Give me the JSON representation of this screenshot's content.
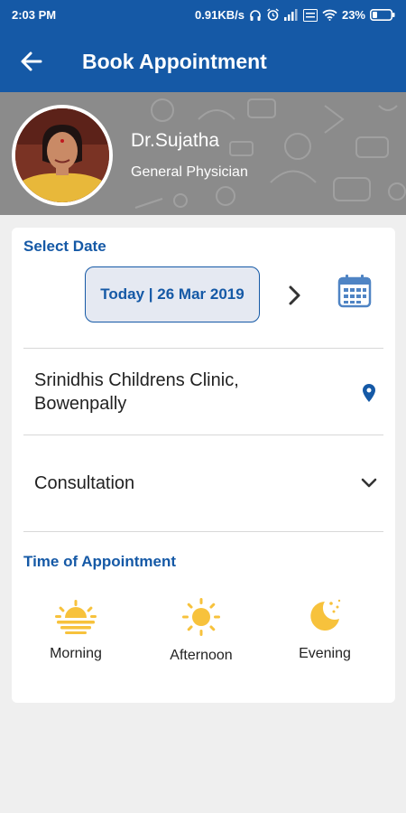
{
  "status_bar": {
    "time": "2:03 PM",
    "speed": "0.91KB/s",
    "battery": "23%"
  },
  "app_bar": {
    "title": "Book Appointment"
  },
  "doctor": {
    "name": "Dr.Sujatha",
    "specialty": "General Physician"
  },
  "date_section": {
    "label": "Select Date",
    "selected": "Today | 26 Mar 2019"
  },
  "clinic": {
    "name": "Srinidhis Childrens Clinic, Bowenpally"
  },
  "consultation": {
    "type": "Consultation"
  },
  "time_section": {
    "label": "Time of Appointment",
    "slots": [
      {
        "label": "Morning",
        "icon": "sunrise-icon"
      },
      {
        "label": "Afternoon",
        "icon": "sun-icon"
      },
      {
        "label": "Evening",
        "icon": "moon-icon"
      }
    ]
  },
  "colors": {
    "primary": "#1559a6",
    "accent": "#f7c23c",
    "header_bg": "#8b8b8b"
  }
}
